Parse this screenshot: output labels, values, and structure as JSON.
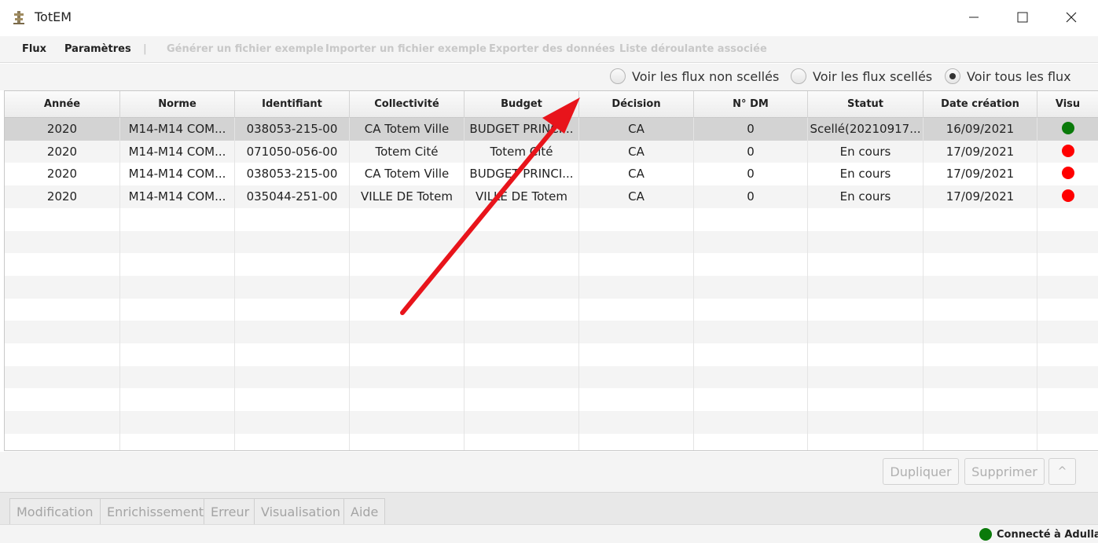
{
  "window": {
    "title": "TotEM",
    "controls": [
      "minimize",
      "maximize",
      "close"
    ]
  },
  "menu": {
    "items": [
      {
        "label": "Flux",
        "enabled": true
      },
      {
        "label": "Paramètres",
        "enabled": true
      },
      {
        "label": "|",
        "enabled": false
      },
      {
        "label": "Générer un fichier exemple",
        "enabled": false
      },
      {
        "label": "Importer un fichier exemple",
        "enabled": false
      },
      {
        "label": "Exporter des données",
        "enabled": false
      },
      {
        "label": "Liste déroulante associée",
        "enabled": false
      }
    ]
  },
  "filters": {
    "options": [
      {
        "label": "Voir les flux non scellés",
        "selected": false
      },
      {
        "label": "Voir les flux scellés",
        "selected": false
      },
      {
        "label": "Voir tous les flux",
        "selected": true
      }
    ]
  },
  "table": {
    "columns": [
      "Année",
      "Norme",
      "Identifiant",
      "Collectivité",
      "Budget",
      "Décision",
      "N° DM",
      "Statut",
      "Date création",
      "Visu"
    ],
    "rows": [
      {
        "annee": "2020",
        "norme": "M14-M14 COM...",
        "identifiant": "038053-215-00",
        "collectivite": "CA Totem Ville",
        "budget": "BUDGET PRINCI...",
        "decision": "CA",
        "dm": "0",
        "statut": "Scellé(20210917...",
        "date": "16/09/2021",
        "visu": "green"
      },
      {
        "annee": "2020",
        "norme": "M14-M14 COM...",
        "identifiant": "071050-056-00",
        "collectivite": "Totem Cité",
        "budget": "Totem Cité",
        "decision": "CA",
        "dm": "0",
        "statut": "En cours",
        "date": "17/09/2021",
        "visu": "red"
      },
      {
        "annee": "2020",
        "norme": "M14-M14 COM...",
        "identifiant": "038053-215-00",
        "collectivite": "CA Totem Ville",
        "budget": "BUDGET PRINCI...",
        "decision": "CA",
        "dm": "0",
        "statut": "En cours",
        "date": "17/09/2021",
        "visu": "red"
      },
      {
        "annee": "2020",
        "norme": "M14-M14 COM...",
        "identifiant": "035044-251-00",
        "collectivite": "VILLE DE Totem",
        "budget": "VILLE DE Totem",
        "decision": "CA",
        "dm": "0",
        "statut": "En cours",
        "date": "17/09/2021",
        "visu": "red"
      }
    ],
    "selected_row": 0
  },
  "actions": {
    "duplicate": "Dupliquer",
    "delete": "Supprimer",
    "collapse": "^"
  },
  "tabs": [
    "Modification",
    "Enrichissement",
    "Erreur",
    "Visualisation",
    "Aide"
  ],
  "status": {
    "connection": "Connecté à Adullact"
  },
  "colors": {
    "green": "#0a7a0a",
    "red": "#ff0000",
    "arrow": "#e8141b",
    "selected_row": "#d3d3d3",
    "stripe": "#f4f4f4"
  }
}
